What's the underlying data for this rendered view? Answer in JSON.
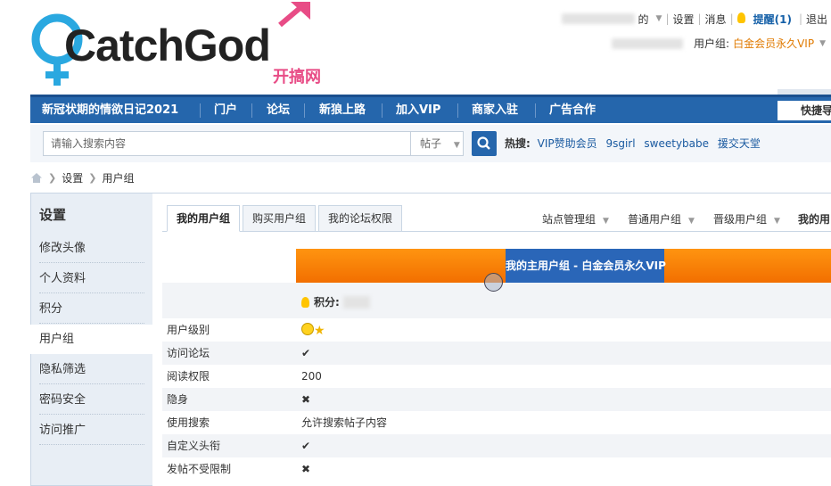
{
  "header": {
    "logo_main": "CatchGod",
    "logo_sub": "开搞网",
    "toplinks": {
      "user_suffix": "的",
      "settings": "设置",
      "messages": "消息",
      "remind": "提醒(1)",
      "logout": "退出"
    },
    "usergroup_label": "用户组:",
    "usergroup_value": "白金会员永久VIP"
  },
  "nav": {
    "items": [
      "新冠状期的情欲日记2021",
      "门户",
      "论坛",
      "新狼上路",
      "加入VIP",
      "商家入驻",
      "广告合作"
    ],
    "quick": "快捷导航"
  },
  "search": {
    "placeholder": "请输入搜索内容",
    "type": "帖子",
    "hot_label": "热搜:",
    "hot_items": [
      "VIP赞助会员",
      "9sgirl",
      "sweetybabe",
      "援交天堂"
    ]
  },
  "breadcrumb": [
    "设置",
    "用户组"
  ],
  "sidebar": {
    "title": "设置",
    "items": [
      "修改头像",
      "个人资料",
      "积分",
      "用户组",
      "隐私筛选",
      "密码安全",
      "访问推广"
    ],
    "active": "用户组"
  },
  "tabs": [
    "我的用户组",
    "购买用户组",
    "我的论坛权限"
  ],
  "group_filters": [
    "站点管理组",
    "普通用户组",
    "晋级用户组",
    "我的用"
  ],
  "main_group_title": "我的主用户组 - 白金会员永久VIP",
  "score_label": "积分:",
  "permissions": [
    {
      "label": "用户级别",
      "value": "",
      "icon": "smile-star"
    },
    {
      "label": "访问论坛",
      "value": "",
      "icon": "check"
    },
    {
      "label": "阅读权限",
      "value": "200",
      "icon": ""
    },
    {
      "label": "隐身",
      "value": "",
      "icon": "cross"
    },
    {
      "label": "使用搜索",
      "value": "允许搜索帖子内容",
      "icon": ""
    },
    {
      "label": "自定义头衔",
      "value": "",
      "icon": "check"
    },
    {
      "label": "发帖不受限制",
      "value": "",
      "icon": "cross"
    }
  ],
  "colors": {
    "nav_blue": "#2566ac",
    "orange": "#f57f00",
    "banner_blue": "#2a66b8",
    "check_green": "#5aa82e",
    "cross_red": "#e55545"
  }
}
